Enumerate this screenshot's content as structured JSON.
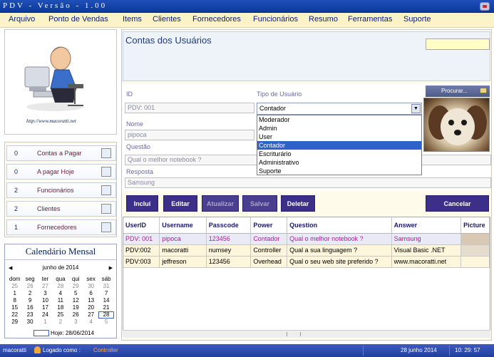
{
  "window": {
    "title": "PDV - Versão - 1.00"
  },
  "menu": [
    "Arquivo",
    "Ponto de Vendas",
    "Items",
    "Clientes",
    "Fornecedores",
    "Funcionários",
    "Resumo",
    "Ferramentas",
    "Suporte"
  ],
  "logo": {
    "url": "http://www.macoratti.net"
  },
  "counters": [
    {
      "count": "0",
      "label": "Contas a Pagar",
      "icon": "checklist-icon"
    },
    {
      "count": "0",
      "label": "A pagar Hoje",
      "icon": "notepad-icon"
    },
    {
      "count": "2",
      "label": "Funcionários",
      "icon": "employee-icon"
    },
    {
      "count": "2",
      "label": "Clientes",
      "icon": "customer-icon"
    },
    {
      "count": "1",
      "label": "Fornecedores",
      "icon": "supplier-icon"
    }
  ],
  "calendar": {
    "title": "Calendário Mensal",
    "month": "junho de 2014",
    "weekdays": [
      "dom",
      "seg",
      "ter",
      "qua",
      "qui",
      "sex",
      "sáb"
    ],
    "weeks": [
      [
        "25",
        "26",
        "27",
        "28",
        "29",
        "30",
        "31"
      ],
      [
        "1",
        "2",
        "3",
        "4",
        "5",
        "6",
        "7"
      ],
      [
        "8",
        "9",
        "10",
        "11",
        "12",
        "13",
        "14"
      ],
      [
        "15",
        "16",
        "17",
        "18",
        "19",
        "20",
        "21"
      ],
      [
        "22",
        "23",
        "24",
        "25",
        "26",
        "27",
        "28"
      ],
      [
        "29",
        "30",
        "1",
        "2",
        "3",
        "4",
        "5"
      ]
    ],
    "today_label": "Hoje: 28/06/2014"
  },
  "panel": {
    "title": "Contas dos Usuários"
  },
  "form": {
    "id_label": "ID",
    "id_value": "PDV: 001",
    "type_label": "Tipo de Usuário",
    "type_selected": "Contador",
    "type_options": [
      "Moderador",
      "Admin",
      "User",
      "Contador",
      "Escriturário",
      "Administrativo",
      "Suporte"
    ],
    "name_label": "Nome",
    "name_value": "pipoca",
    "question_label": "Questão",
    "question_value": "Qual o melhor notebook ?",
    "answer_label": "Resposta",
    "answer_value": "Samsung",
    "browse_label": "Procurar..."
  },
  "actions": {
    "include": "Incluí",
    "edit": "Editar",
    "update": "Atualizar",
    "save": "Salvar",
    "delete": "Deletar",
    "cancel": "Cancelar"
  },
  "grid": {
    "columns": [
      "UserID",
      "Username",
      "Passcode",
      "Power",
      "Question",
      "Answer",
      "Picture"
    ],
    "rows": [
      [
        "PDV: 001",
        "pipoca",
        "123456",
        "Contador",
        "Qual o melhor notebook ?",
        "Samsung",
        ""
      ],
      [
        "PDV:002",
        "macoratti",
        "numsey",
        "Controller",
        "Qual a sua linguagem ?",
        "Visual Basic .NET",
        ""
      ],
      [
        "PDV:003",
        "jeffreson",
        "123456",
        "Overhead",
        "Qual o seu web site preferido ?",
        "www.macoratti.net",
        ""
      ]
    ]
  },
  "status": {
    "user": "macoratti",
    "logged_label": "Logado como :",
    "role": "Controller",
    "date": "28  junho  2014",
    "time": "10: 29: 57"
  },
  "colors": {
    "title_bar": "#0b3a9c",
    "menu_bg": "#fbf3c7",
    "button": "#3b2f8a",
    "selection": "#2f62c9"
  }
}
